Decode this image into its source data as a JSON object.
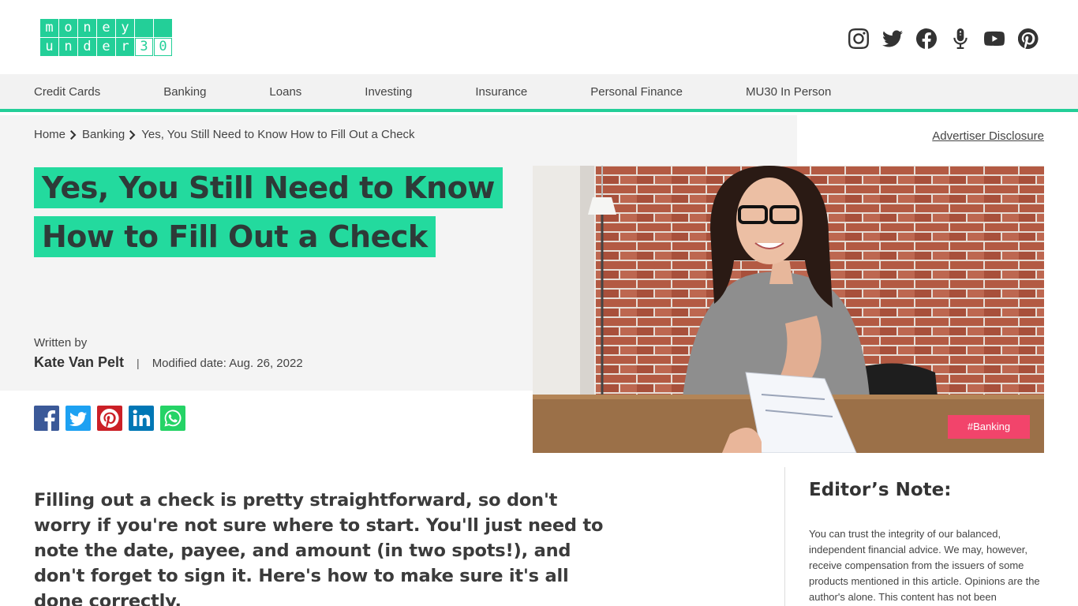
{
  "logo": {
    "row1": [
      "m",
      "o",
      "n",
      "e",
      "y",
      "",
      ""
    ],
    "row2": [
      "u",
      "n",
      "d",
      "e",
      "r",
      "3",
      "0"
    ]
  },
  "social_icons": [
    "instagram-icon",
    "twitter-icon",
    "facebook-icon",
    "microphone-icon",
    "youtube-icon",
    "pinterest-icon"
  ],
  "nav": {
    "items": [
      "Credit Cards",
      "Banking",
      "Loans",
      "Investing",
      "Insurance",
      "Personal Finance",
      "MU30 In Person"
    ]
  },
  "breadcrumb": {
    "home": "Home",
    "section": "Banking",
    "current": "Yes, You Still Need to Know How to Fill Out a Check"
  },
  "advertiser_disclosure": "Advertiser Disclosure",
  "article": {
    "title_line1": "Yes, You Still Need to Know",
    "title_line2": "How to Fill Out a Check",
    "written_by": "Written by",
    "author": "Kate Van Pelt",
    "separator": "|",
    "modified": "Modified date: Aug. 26, 2022",
    "tag": "#Banking",
    "lead": "Filling out a check is pretty straightforward, so don't worry if you're not sure where to start. You'll just need to note the date, payee, and amount (in two spots!), and don't forget to sign it. Here's how to make sure it's all done correctly."
  },
  "share_icons": [
    "facebook-share-icon",
    "twitter-share-icon",
    "pinterest-share-icon",
    "linkedin-share-icon",
    "whatsapp-share-icon"
  ],
  "editor_note": {
    "title": "Editor’s Note:",
    "text": "You can trust the integrity of our balanced, independent financial advice. We may, however, receive compensation from the issuers of some products mentioned in this article. Opinions are the author's alone. This content has not been"
  },
  "colors": {
    "brand": "#23cf98",
    "tag": "#f2446b",
    "facebook": "#3b5998",
    "twitter": "#1da1f2",
    "pinterest": "#cb2027",
    "linkedin": "#0077b5",
    "whatsapp": "#25d366"
  }
}
